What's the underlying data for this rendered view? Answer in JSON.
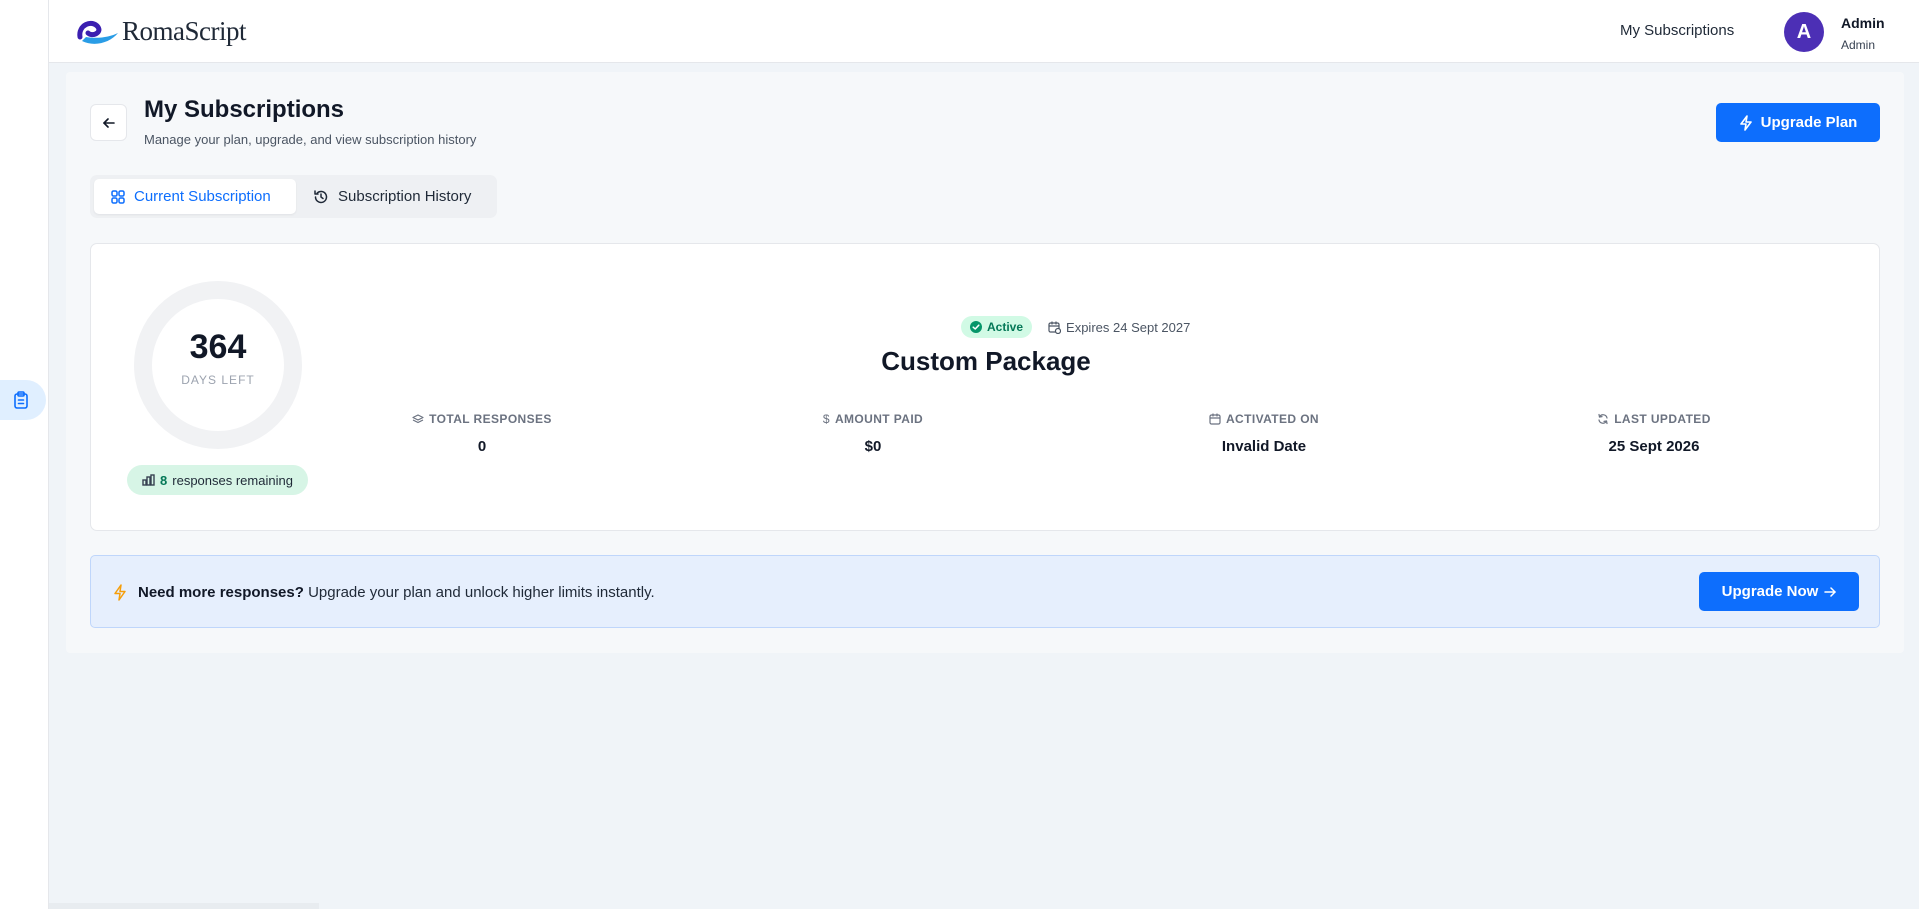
{
  "brand": {
    "name": "RomaScript"
  },
  "header": {
    "nav_link": "My Subscriptions",
    "user": {
      "initial": "A",
      "name": "Admin",
      "role": "Admin"
    }
  },
  "page": {
    "title": "My Subscriptions",
    "subtitle": "Manage your plan, upgrade, and view subscription history",
    "upgrade_button": "Upgrade Plan"
  },
  "tabs": [
    {
      "label": "Current Subscription",
      "active": true,
      "icon": "grid-icon"
    },
    {
      "label": "Subscription History",
      "active": false,
      "icon": "history-icon"
    }
  ],
  "subscription": {
    "days_left": "364",
    "days_left_label": "DAYS LEFT",
    "responses_remaining_count": "8",
    "responses_remaining_text": "responses remaining",
    "status": "Active",
    "expires": "Expires 24 Sept 2027",
    "plan_name": "Custom Package",
    "stats": [
      {
        "label": "TOTAL RESPONSES",
        "value": "0",
        "icon": "layers-icon"
      },
      {
        "label": "AMOUNT PAID",
        "value": "$0",
        "icon": "dollar-icon"
      },
      {
        "label": "ACTIVATED ON",
        "value": "Invalid Date",
        "icon": "calendar-icon"
      },
      {
        "label": "LAST UPDATED",
        "value": "25 Sept 2026",
        "icon": "refresh-icon"
      }
    ]
  },
  "banner": {
    "bold": "Need more responses?",
    "text": " Upgrade your plan and unlock higher limits instantly.",
    "button": "Upgrade Now"
  },
  "colors": {
    "primary": "#0d6efd",
    "avatar": "#4c2fb5",
    "success": "#047857",
    "success_bg": "#d1fae5",
    "warning_icon": "#f59e0b"
  }
}
